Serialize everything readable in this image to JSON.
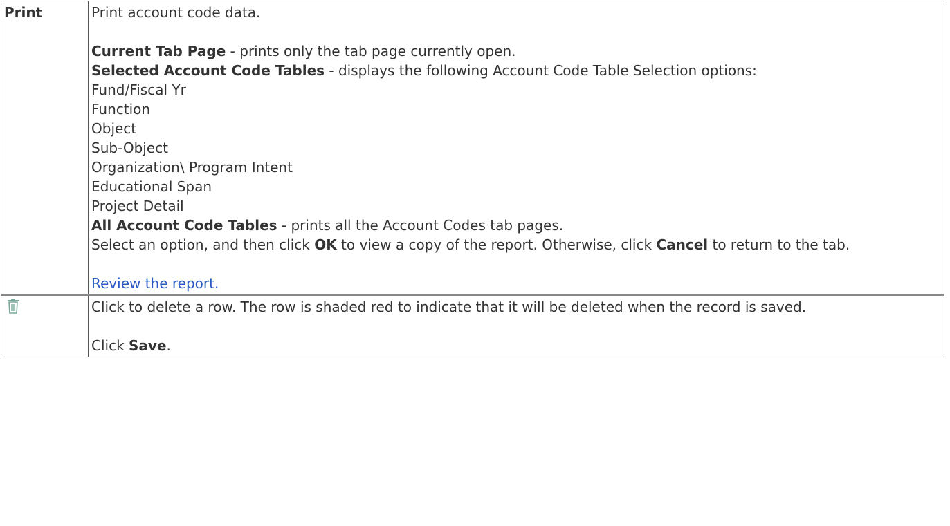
{
  "rows": [
    {
      "key_label": "Print",
      "intro": "Print account code data.",
      "options": [
        {
          "bold": "Current Tab Page",
          "text": " - prints only the tab page currently open."
        },
        {
          "bold": "Selected Account Code Tables",
          "text": " - displays the following Account Code Table Selection options:"
        }
      ],
      "tables_list": [
        "Fund/Fiscal Yr",
        "Function",
        "Object",
        "Sub-Object",
        "Organization\\ Program Intent",
        "Educational Span",
        "Project Detail"
      ],
      "all_option": {
        "bold": "All Account Code Tables",
        "text": " - prints all the Account Codes tab pages."
      },
      "select_text": {
        "part1": "Select an option, and then click ",
        "ok": "OK",
        "part2": " to view a copy of the report. Otherwise, click ",
        "cancel": "Cancel",
        "part3": " to return to the tab."
      },
      "review_link": "Review the report."
    },
    {
      "key_icon": "trash-icon",
      "description": "Click to delete a row. The row is shaded red to indicate that it will be deleted when the record is saved.",
      "click_prefix": "Click ",
      "save_label": "Save",
      "click_suffix": "."
    }
  ],
  "colors": {
    "link": "#2b59c3",
    "icon": "#7aa79a",
    "border": "#555555"
  }
}
